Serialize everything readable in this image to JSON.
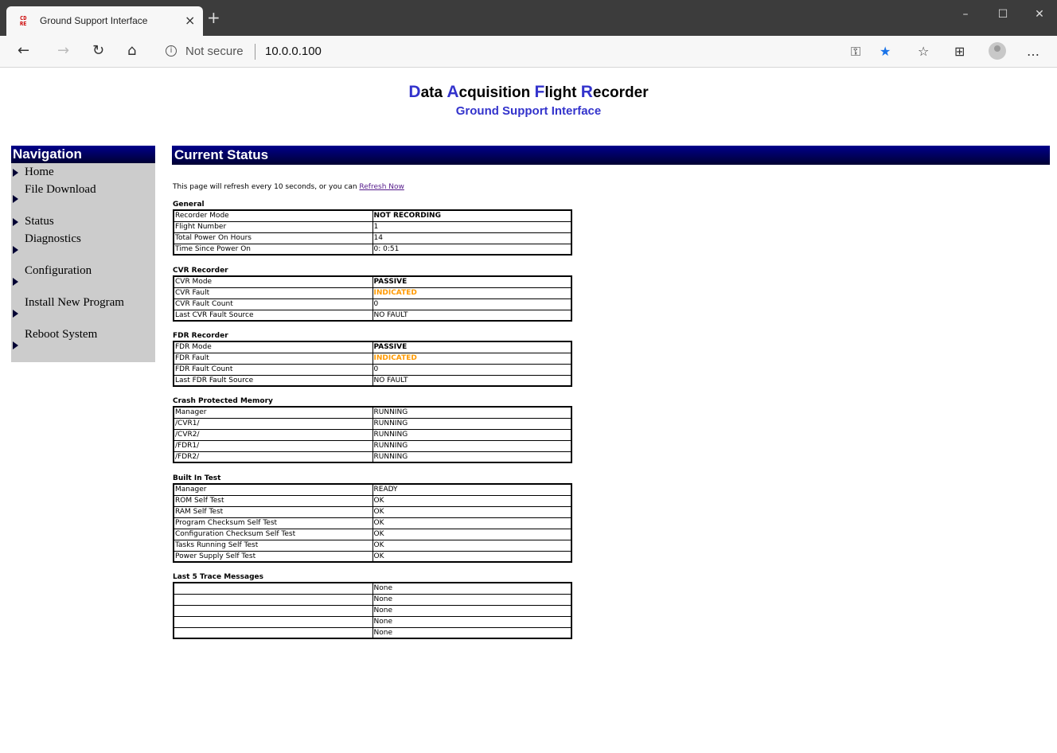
{
  "browser": {
    "tab_title": "Ground Support Interface",
    "favicon_text": "CD RE",
    "tab_close": "×",
    "new_tab": "+",
    "win_min": "–",
    "win_max": "☐",
    "win_close": "✕",
    "not_secure": "Not secure",
    "url": "10.0.0.100"
  },
  "header": {
    "title_parts": [
      {
        "cap": "D",
        "rest": "ata "
      },
      {
        "cap": "A",
        "rest": "cquisition "
      },
      {
        "cap": "F",
        "rest": "light "
      },
      {
        "cap": "R",
        "rest": "ecorder"
      }
    ],
    "subtitle": "Ground Support Interface"
  },
  "navigation": {
    "title": "Navigation",
    "items": [
      "Home",
      "File Download",
      "Status",
      "Diagnostics",
      "Configuration",
      "Install New Program",
      "Reboot System"
    ]
  },
  "status": {
    "title": "Current Status",
    "intro_text": "This page will refresh every 10 seconds, or you can ",
    "refresh_link": "Refresh Now",
    "sections": [
      {
        "title": "General",
        "rows": [
          {
            "k": "Recorder Mode",
            "v": "NOT RECORDING",
            "style": "bold"
          },
          {
            "k": "Flight Number",
            "v": "1"
          },
          {
            "k": "Total Power On Hours",
            "v": "14"
          },
          {
            "k": "Time Since Power On",
            "v": "0: 0:51"
          }
        ]
      },
      {
        "title": "CVR Recorder",
        "rows": [
          {
            "k": "CVR Mode",
            "v": "PASSIVE",
            "style": "bold"
          },
          {
            "k": "CVR Fault",
            "v": "INDICATED",
            "style": "warn"
          },
          {
            "k": "CVR Fault Count",
            "v": "0"
          },
          {
            "k": "Last CVR Fault Source",
            "v": "NO FAULT"
          }
        ]
      },
      {
        "title": "FDR Recorder",
        "rows": [
          {
            "k": "FDR Mode",
            "v": "PASSIVE",
            "style": "bold"
          },
          {
            "k": "FDR Fault",
            "v": "INDICATED",
            "style": "warn"
          },
          {
            "k": "FDR Fault Count",
            "v": "0"
          },
          {
            "k": "Last FDR Fault Source",
            "v": "NO FAULT"
          }
        ]
      },
      {
        "title": "Crash Protected Memory",
        "rows": [
          {
            "k": "Manager",
            "v": "RUNNING"
          },
          {
            "k": "/CVR1/",
            "v": "RUNNING"
          },
          {
            "k": "/CVR2/",
            "v": "RUNNING"
          },
          {
            "k": "/FDR1/",
            "v": "RUNNING"
          },
          {
            "k": "/FDR2/",
            "v": "RUNNING"
          }
        ]
      },
      {
        "title": "Built In Test",
        "rows": [
          {
            "k": "Manager",
            "v": "READY"
          },
          {
            "k": "ROM Self Test",
            "v": "OK"
          },
          {
            "k": "RAM Self Test",
            "v": "OK"
          },
          {
            "k": "Program Checksum Self Test",
            "v": "OK"
          },
          {
            "k": "Configuration Checksum Self Test",
            "v": "OK"
          },
          {
            "k": "Tasks Running Self Test",
            "v": "OK"
          },
          {
            "k": "Power Supply Self Test",
            "v": "OK"
          }
        ]
      },
      {
        "title": "Last 5 Trace Messages",
        "rows": [
          {
            "k": "",
            "v": "None"
          },
          {
            "k": "",
            "v": "None"
          },
          {
            "k": "",
            "v": "None"
          },
          {
            "k": "",
            "v": "None"
          },
          {
            "k": "",
            "v": "None"
          }
        ]
      }
    ]
  }
}
